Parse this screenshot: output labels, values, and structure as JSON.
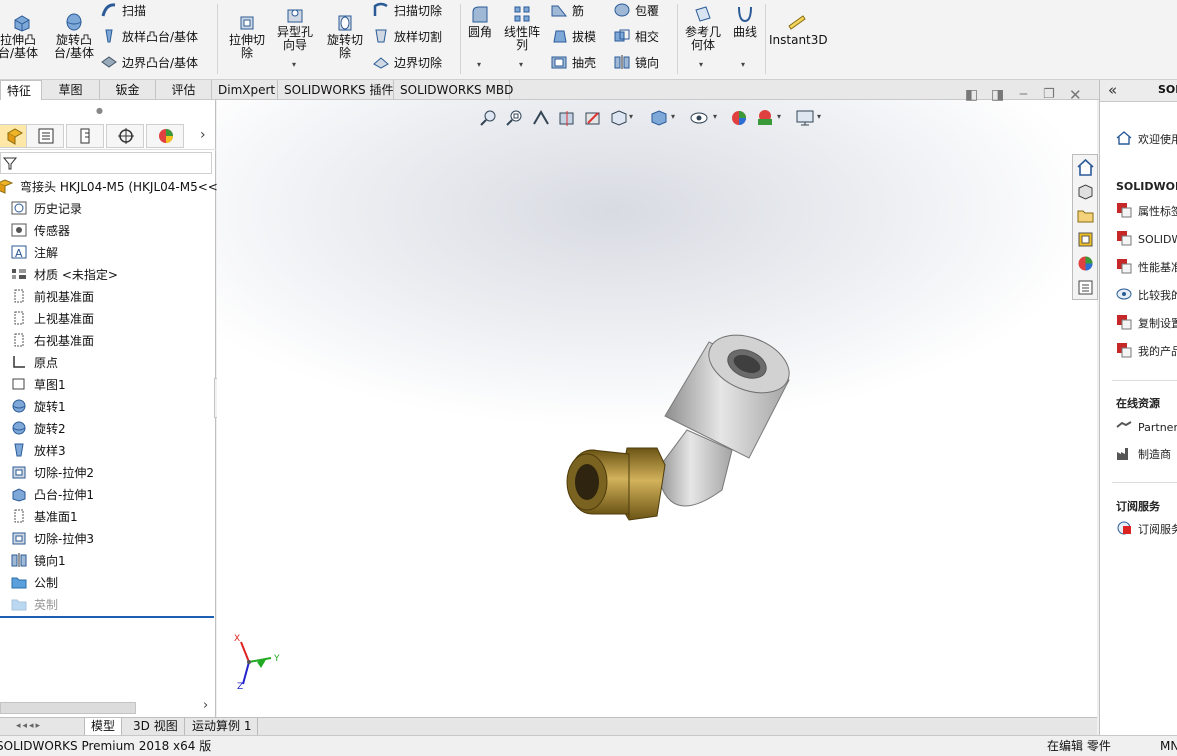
{
  "ribbon": {
    "extrude_boss": "拉伸凸台/基体",
    "revolve_boss": "旋转凸台/基体",
    "sweep": "扫描",
    "loft_boss": "放样凸台/基体",
    "boundary_boss": "边界凸台/基体",
    "extrude_cut": "拉伸切除",
    "hole_wizard": "异型孔向导",
    "revolve_cut": "旋转切除",
    "sweep_cut": "扫描切除",
    "loft_cut": "放样切割",
    "boundary_cut": "边界切除",
    "fillet": "圆角",
    "linear_pattern": "线性阵列",
    "rib": "筋",
    "draft": "拔模",
    "shell": "抽壳",
    "wrap": "包覆",
    "intersect": "相交",
    "mirror": "镜向",
    "reference_geometry": "参考几何体",
    "curves": "曲线",
    "instant3d": "Instant3D"
  },
  "tabs": [
    "特征",
    "草图",
    "钣金",
    "评估",
    "DimXpert",
    "SOLIDWORKS 插件",
    "SOLIDWORKS MBD"
  ],
  "tree": {
    "root": "弯接头 HKJL04-M5 (HKJL04-M5<<",
    "items": [
      "历史记录",
      "传感器",
      "注解",
      "材质 <未指定>",
      "前视基准面",
      "上视基准面",
      "右视基准面",
      "原点",
      "草图1",
      "旋转1",
      "旋转2",
      "放样3",
      "切除-拉伸2",
      "凸台-拉伸1",
      "基准面1",
      "切除-拉伸3",
      "镜向1",
      "公制",
      "英制"
    ]
  },
  "bottom_tabs": [
    "模型",
    "3D 视图",
    "运动算例 1"
  ],
  "status": {
    "product": "SOLIDWORKS Premium 2018 x64 版",
    "mode": "在编辑 零件",
    "units": "MN"
  },
  "task_pane": {
    "welcome": "欢迎使用",
    "section_solidworks": "SOLIDWORKS",
    "items": [
      "属性标签",
      "SOLIDW",
      "性能基准",
      "比较我的",
      "复制设置",
      "我的产品"
    ],
    "section_online": "在线资源",
    "online_items": [
      "Partner",
      "制造商"
    ],
    "section_subscription": "订阅服务",
    "subscription_items": [
      "订阅服务"
    ]
  },
  "triad": {
    "x": "X",
    "y": "Y",
    "z": "Z"
  },
  "colors": {
    "accent_blue": "#1c5fb4",
    "brass": "#a88a3c",
    "steel": "#c8c8c8"
  }
}
